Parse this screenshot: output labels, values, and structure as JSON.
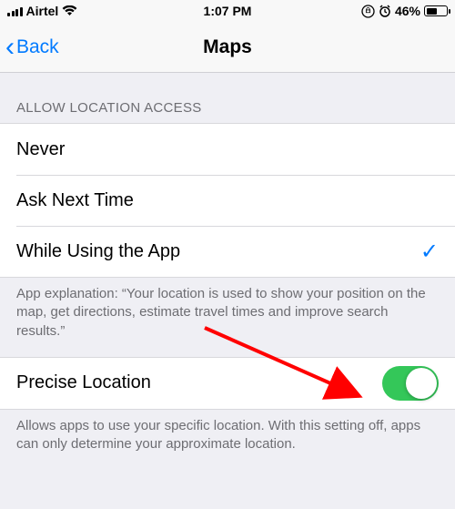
{
  "status": {
    "carrier": "Airtel",
    "time": "1:07 PM",
    "battery_pct": "46%"
  },
  "nav": {
    "back_label": "Back",
    "title": "Maps"
  },
  "section1": {
    "header": "ALLOW LOCATION ACCESS",
    "options": {
      "never": "Never",
      "ask": "Ask Next Time",
      "while": "While Using the App"
    },
    "selected_index": 2,
    "explanation": "App explanation: “Your location is used to show your position on the map, get directions, estimate travel times and improve search results.”"
  },
  "section2": {
    "label": "Precise Location",
    "toggle_on": true,
    "footer": "Allows apps to use your specific location. With this setting off, apps can only determine your approximate location."
  }
}
